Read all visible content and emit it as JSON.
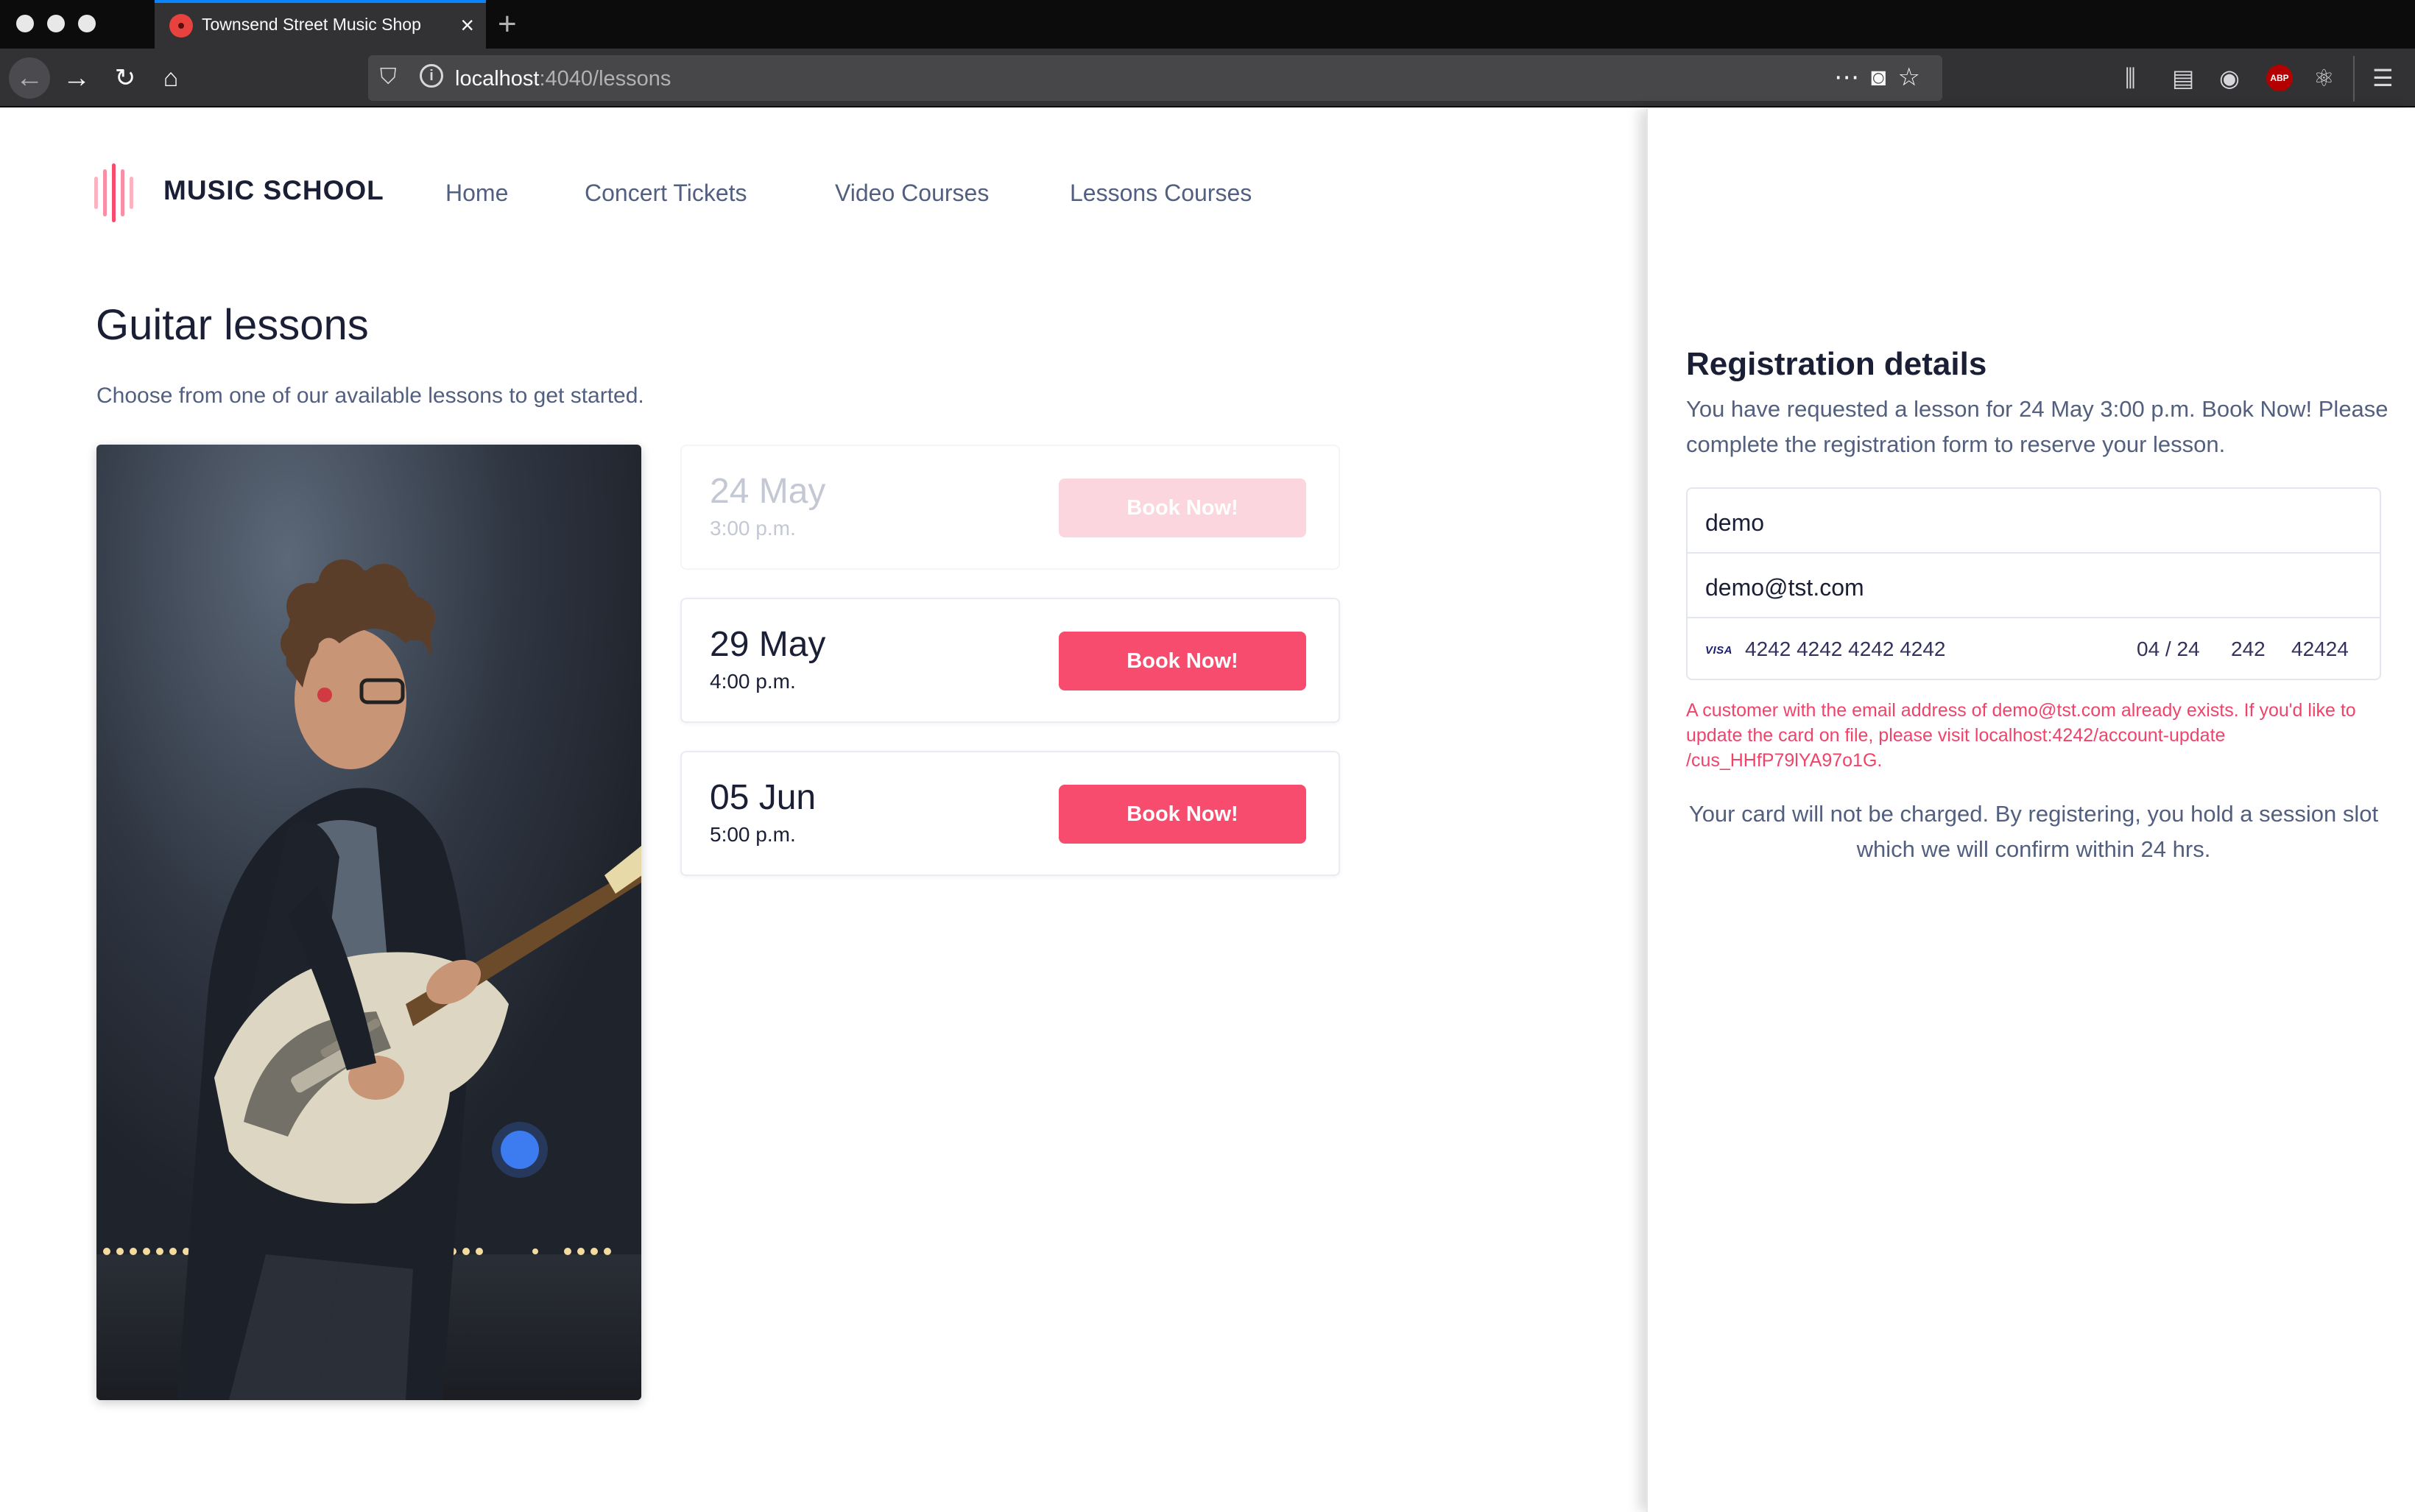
{
  "browser": {
    "tab_title": "Townsend Street Music Shop",
    "url_host": "localhost",
    "url_path": ":4040/lessons",
    "icons": [
      "back-icon",
      "forward-icon",
      "reload-icon",
      "home-icon",
      "shield-icon",
      "info-icon",
      "more-icon",
      "pocket-icon",
      "bookmark-star-icon",
      "library-icon",
      "sidebar-icon",
      "account-icon",
      "adblock-icon",
      "extension-icon",
      "menu-icon"
    ],
    "adblock_label": "ABP"
  },
  "site": {
    "logo_text": "MUSIC SCHOOL",
    "nav": [
      {
        "label": "Home"
      },
      {
        "label": "Concert Tickets"
      },
      {
        "label": "Video Courses"
      },
      {
        "label": "Lessons Courses"
      }
    ]
  },
  "main": {
    "title": "Guitar lessons",
    "subtitle": "Choose from one of our available lessons to get started.",
    "lessons": [
      {
        "date": "24 May",
        "time": "3:00 p.m.",
        "button": "Book Now!",
        "state": "selected"
      },
      {
        "date": "29 May",
        "time": "4:00 p.m.",
        "button": "Book Now!",
        "state": "available"
      },
      {
        "date": "05 Jun",
        "time": "5:00 p.m.",
        "button": "Book Now!",
        "state": "available"
      }
    ]
  },
  "registration": {
    "title": "Registration details",
    "description": "You have requested a lesson for 24 May 3:00 p.m. Book Now! Please complete the registration form to reserve your lesson.",
    "name_value": "demo",
    "email_value": "demo@tst.com",
    "card": {
      "brand": "VISA",
      "number": "4242 4242 4242 4242",
      "expiry": "04 / 24",
      "cvc": "242",
      "zip": "42424"
    },
    "error": "A customer with the email address of demo@tst.com already exists. If you'd like to update the card on file, please visit localhost:4242/account-update /cus_HHfP79lYA97o1G.",
    "notice": "Your card will not be charged. By registering, you hold a session slot which we will confirm within 24 hrs."
  },
  "colors": {
    "accent": "#f74c6d",
    "accent_faded": "#fcd6de",
    "error": "#f0436a",
    "text_dark": "#1a1f36",
    "text_muted": "#525f7f",
    "browser_tab_active": "#0a84ff"
  }
}
